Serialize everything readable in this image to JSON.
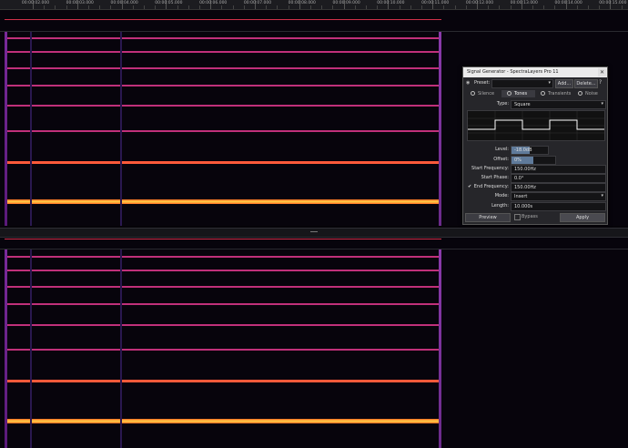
{
  "ruler": {
    "labels": [
      "00:00:02.000",
      "00:00:03.000",
      "00:00:04.000",
      "00:00:05.000",
      "00:00:06.000",
      "00:00:07.000",
      "00:00:08.000",
      "00:00:09.000",
      "00:00:10.000",
      "00:00:11.000",
      "00:00:12.000",
      "00:00:13.000",
      "00:00:14.000",
      "00:00:15.000"
    ]
  },
  "colors": {
    "background": "#050308",
    "line_magenta": "#c0307a",
    "line_hot": "#ff9a2a",
    "marker_red": "#d0304a"
  },
  "dialog": {
    "title": "Signal Generator - SpectraLayers Pro 11",
    "close_icon": "close-icon",
    "preset_label": "Preset:",
    "preset_value": "",
    "add_label": "Add...",
    "delete_label": "Delete...",
    "help_icon": "help-icon",
    "tabs": [
      {
        "label": "Silence",
        "selected": false
      },
      {
        "label": "Tones",
        "selected": true
      },
      {
        "label": "Transients",
        "selected": false
      },
      {
        "label": "Noise",
        "selected": false
      }
    ],
    "type_label": "Type:",
    "type_value": "Square",
    "level_label": "Level:",
    "level_value": "-18.0dB",
    "level_fraction": 0.5,
    "offset_label": "Offset:",
    "offset_value": "0%",
    "offset_fraction": 0.5,
    "start_freq_label": "Start Frequency:",
    "start_freq_value": "150.00Hz",
    "start_phase_label": "Start Phase:",
    "start_phase_value": "0.0°",
    "end_freq_label": "End Frequency:",
    "end_freq_value": "150.00Hz",
    "end_freq_checked": true,
    "mode_label": "Mode:",
    "mode_value": "Insert",
    "length_label": "Length:",
    "length_value": "10.000s",
    "preview_label": "Preview",
    "bypass_label": "Bypass",
    "apply_label": "Apply"
  }
}
